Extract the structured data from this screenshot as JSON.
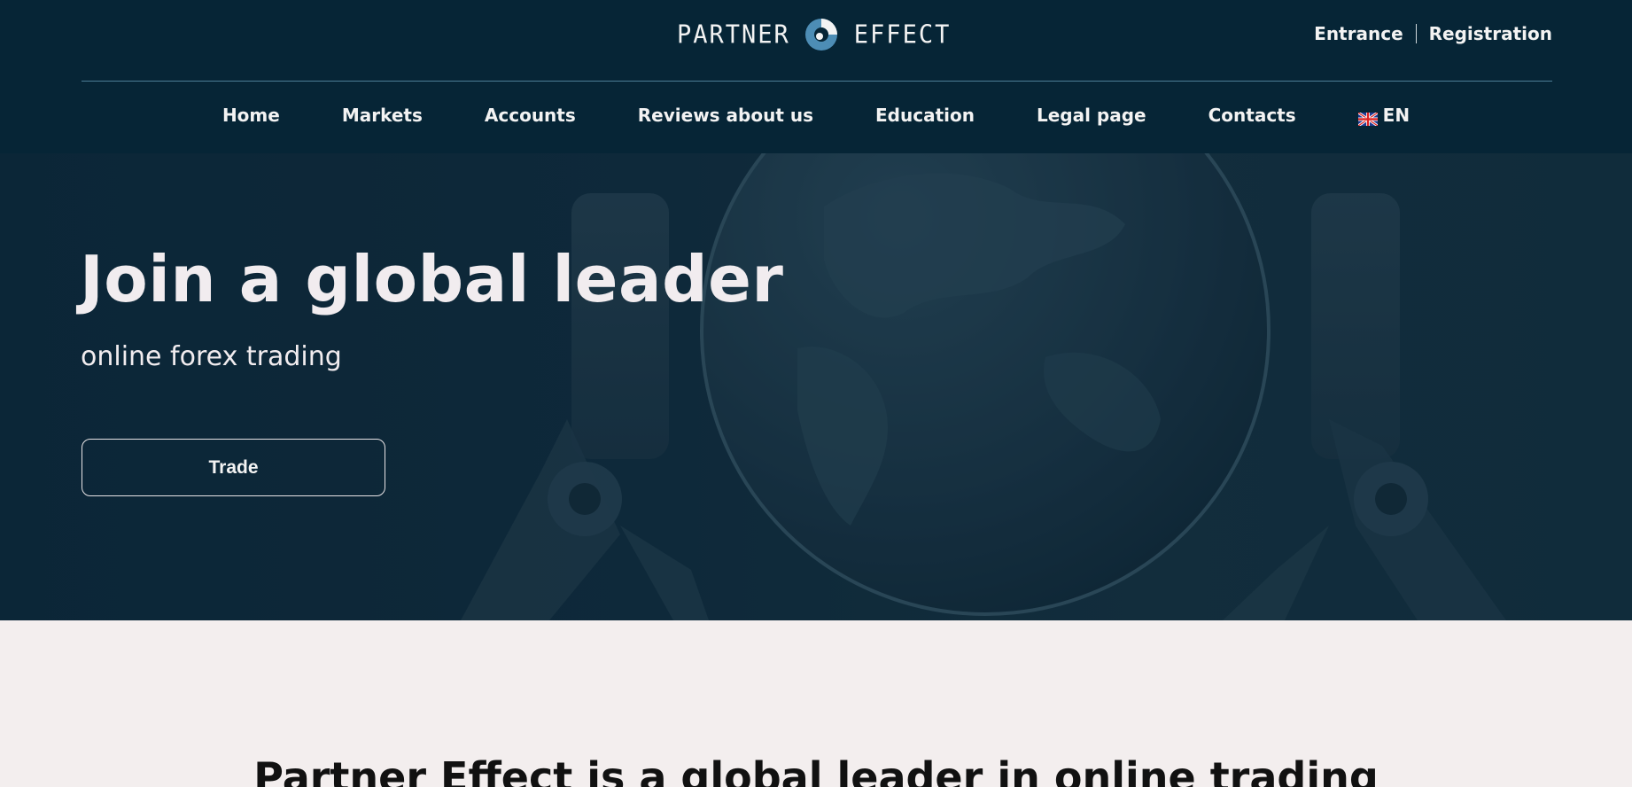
{
  "header": {
    "logo": {
      "left_word": "PARTNER",
      "right_word": "EFFECT"
    },
    "auth": {
      "login": "Entrance",
      "register": "Registration"
    },
    "nav": [
      {
        "label": "Home"
      },
      {
        "label": "Markets"
      },
      {
        "label": "Accounts"
      },
      {
        "label": "Reviews about us"
      },
      {
        "label": "Education"
      },
      {
        "label": "Legal page"
      },
      {
        "label": "Contacts"
      }
    ],
    "language": {
      "label": "EN",
      "flag_icon": "uk-flag-icon"
    }
  },
  "hero": {
    "title": "Join a global leader",
    "subtitle": "online forex trading",
    "cta_label": "Trade",
    "background_image": "globe-held-by-robotic-arms"
  },
  "intro": {
    "title": "Partner Effect is a global leader in online trading"
  },
  "colors": {
    "header_bg": "#062536",
    "hero_bg": "#0f2a3a",
    "accent": "#4d8db5",
    "text_light": "#f1ecef",
    "page_bg": "#f3eeee"
  }
}
